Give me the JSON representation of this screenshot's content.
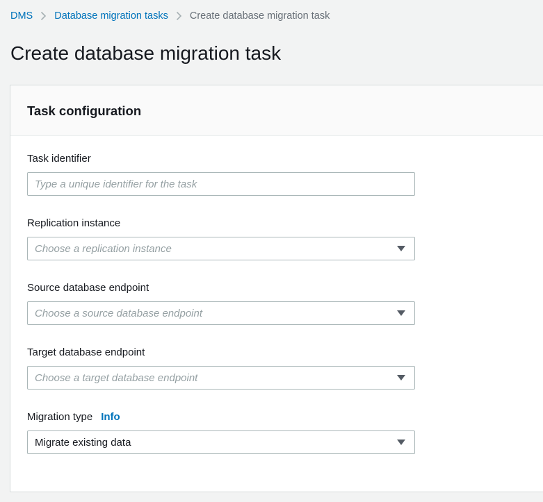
{
  "breadcrumb": {
    "items": [
      {
        "label": "DMS"
      },
      {
        "label": "Database migration tasks"
      },
      {
        "label": "Create database migration task"
      }
    ]
  },
  "page_title": "Create database migration task",
  "panel": {
    "title": "Task configuration",
    "fields": {
      "task_identifier": {
        "label": "Task identifier",
        "placeholder": "Type a unique identifier for the task",
        "value": ""
      },
      "replication_instance": {
        "label": "Replication instance",
        "placeholder": "Choose a replication instance"
      },
      "source_endpoint": {
        "label": "Source database endpoint",
        "placeholder": "Choose a source database endpoint"
      },
      "target_endpoint": {
        "label": "Target database endpoint",
        "placeholder": "Choose a target database endpoint"
      },
      "migration_type": {
        "label": "Migration type",
        "info_label": "Info",
        "value": "Migrate existing data"
      }
    }
  },
  "icons": {
    "breadcrumb_separator": "chevron-right-icon",
    "dropdown": "caret-down-icon"
  },
  "colors": {
    "link_blue": "#0073bb",
    "page_background": "#f2f3f3",
    "card_background": "#ffffff",
    "card_header_background": "#fafafa",
    "card_border": "#d5dbdb",
    "input_border": "#aab7b8",
    "placeholder_text": "#95a0a3",
    "breadcrumb_current_text": "#687078",
    "caret": "#545b64",
    "heading_text": "#16191f"
  }
}
